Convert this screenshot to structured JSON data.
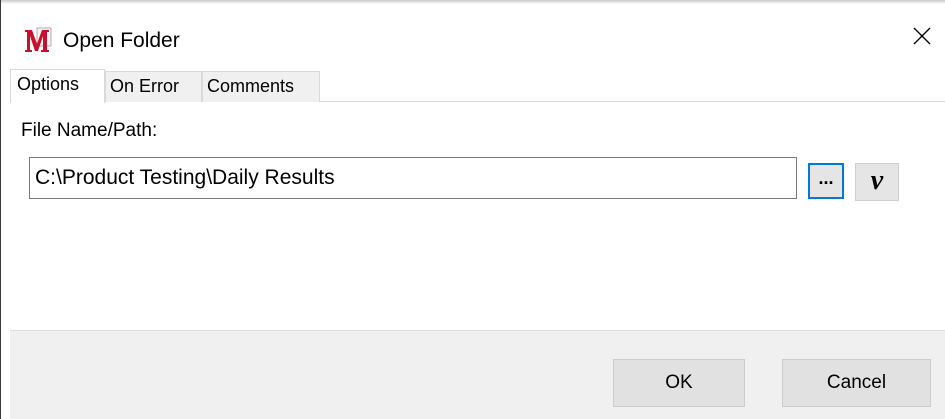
{
  "window": {
    "title": "Open Folder",
    "app_icon": "macro-m-icon",
    "close_icon": "close-icon"
  },
  "tabs": [
    {
      "label": "Options",
      "active": true
    },
    {
      "label": "On Error",
      "active": false
    },
    {
      "label": "Comments",
      "active": false
    }
  ],
  "options": {
    "file_path_label": "File Name/Path:",
    "file_path_value": "C:\\Product Testing\\Daily Results",
    "browse_label": "...",
    "variable_label": "v"
  },
  "footer": {
    "ok_label": "OK",
    "cancel_label": "Cancel"
  },
  "colors": {
    "focus_border": "#0078d7",
    "icon_red": "#c8102e",
    "button_face": "#e1e1e1",
    "footer_bg": "#f0f0f0"
  }
}
